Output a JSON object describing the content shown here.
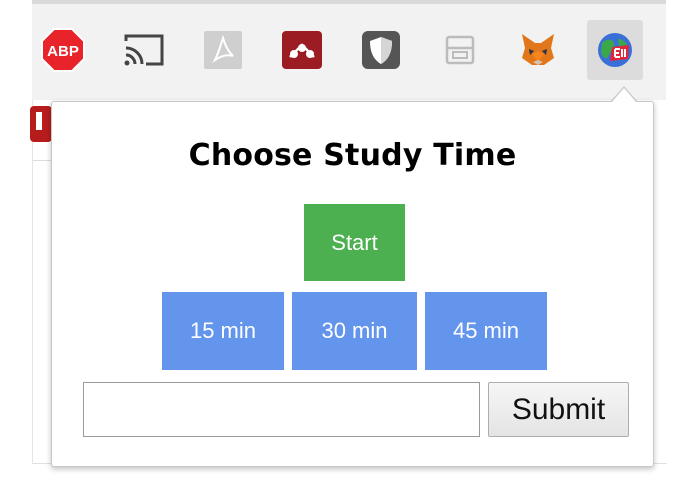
{
  "toolbar": {
    "extensions": [
      {
        "id": "adblock-plus",
        "label": "ABP",
        "color": "#e8242a"
      },
      {
        "id": "cast",
        "label": ""
      },
      {
        "id": "acrobat",
        "label": ""
      },
      {
        "id": "mendeley",
        "label": "",
        "color": "#9c1c23"
      },
      {
        "id": "shield",
        "label": ""
      },
      {
        "id": "reader",
        "label": ""
      },
      {
        "id": "metamask",
        "label": "",
        "color": "#e2761b"
      },
      {
        "id": "study-timer",
        "label": "",
        "active": true
      }
    ]
  },
  "popup": {
    "title": "Choose Study Time",
    "start_label": "Start",
    "presets": [
      "15 min",
      "30 min",
      "45 min"
    ],
    "custom_input": {
      "value": "",
      "placeholder": ""
    },
    "submit_label": "Submit"
  },
  "colors": {
    "start": "#4caf50",
    "preset": "#6495ed",
    "abp": "#e8242a",
    "mendeley": "#9c1c23",
    "metamask": "#e2761b"
  }
}
